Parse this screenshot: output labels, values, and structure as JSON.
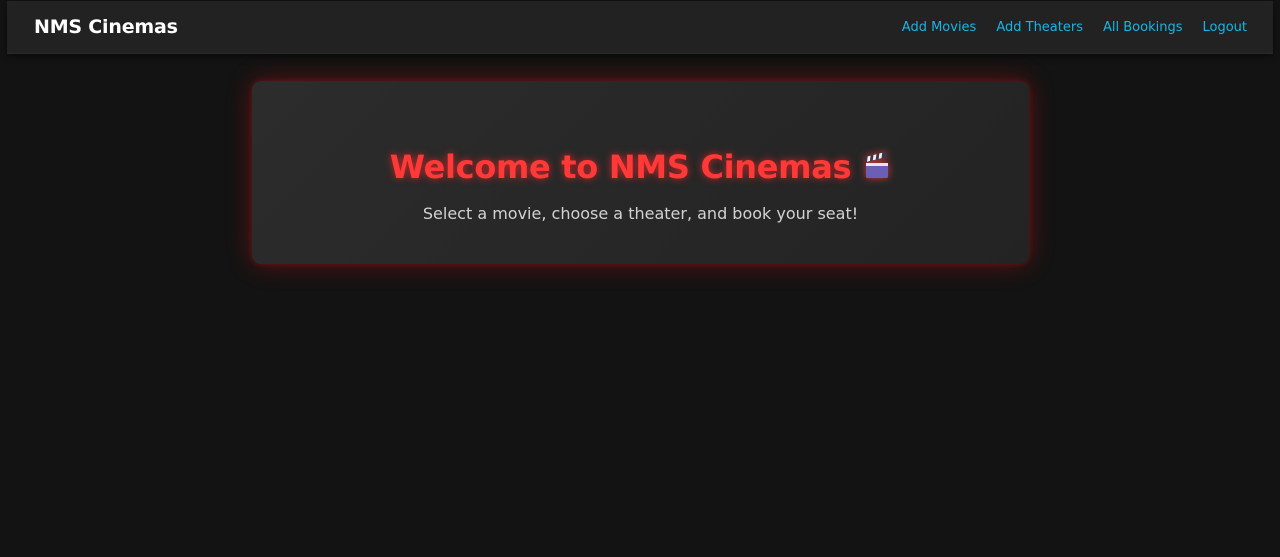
{
  "navbar": {
    "brand": "NMS Cinemas",
    "links": [
      {
        "label": "Add Movies"
      },
      {
        "label": "Add Theaters"
      },
      {
        "label": "All Bookings"
      },
      {
        "label": "Logout"
      }
    ],
    "link_color": "#17b5e6",
    "background": "#222222"
  },
  "hero": {
    "title": "Welcome to NMS Cinemas",
    "title_icon": "clapper-board-icon",
    "subtitle": "Select a movie, choose a theater, and book your seat!",
    "title_color": "#ff3838",
    "glow_color": "#ff2020"
  },
  "page": {
    "background": "#131313"
  }
}
